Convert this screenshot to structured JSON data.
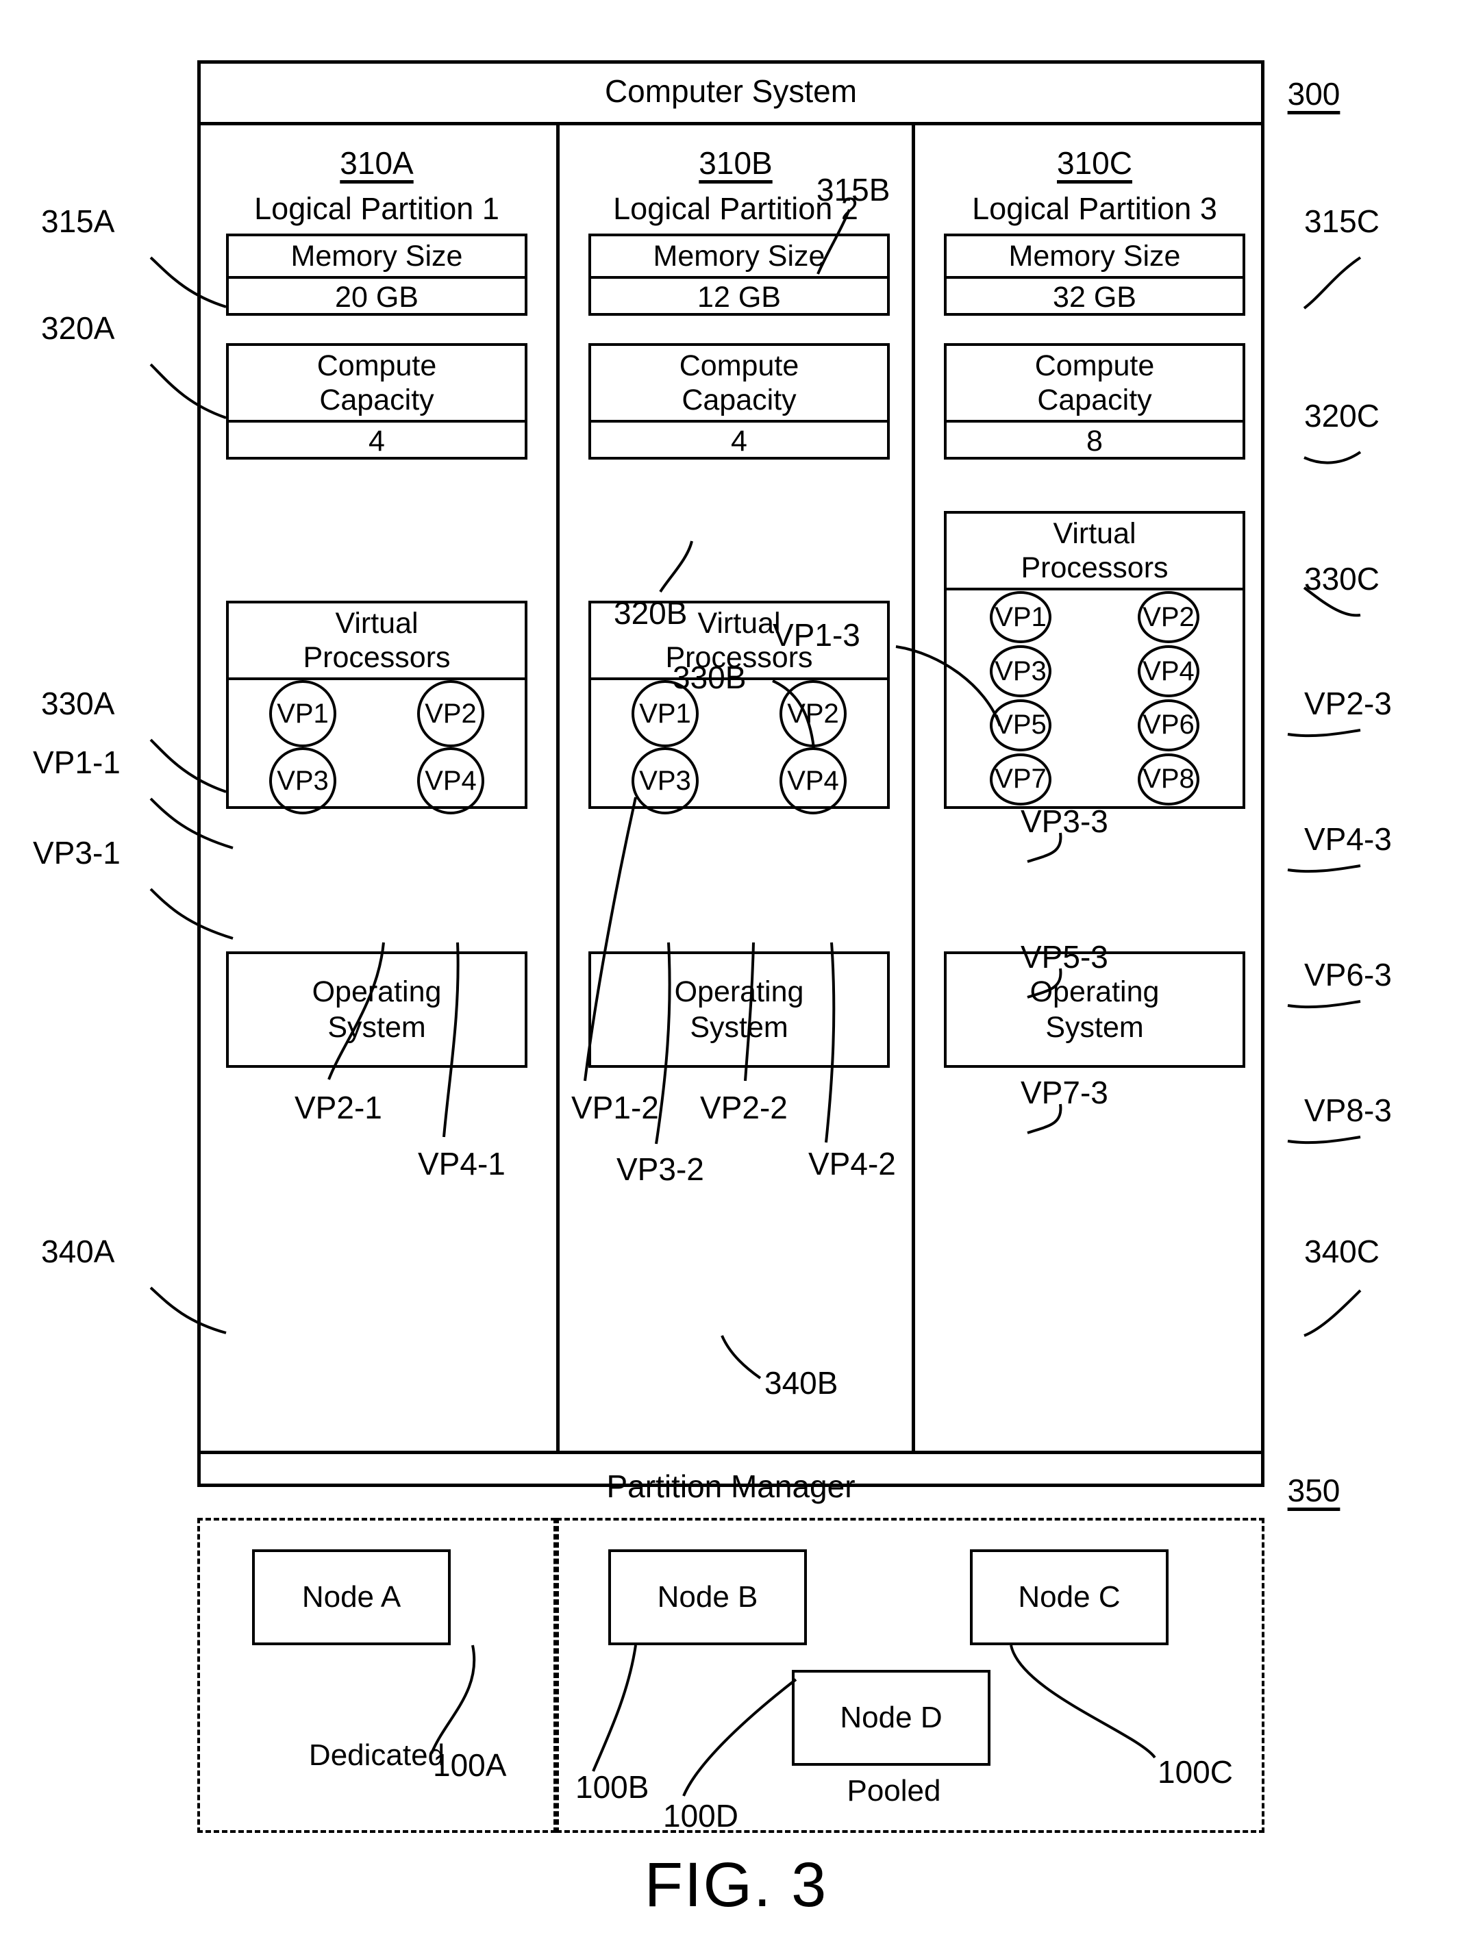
{
  "figure": {
    "caption": "FIG. 3"
  },
  "system": {
    "title": "Computer System",
    "ref": "300"
  },
  "partition_manager": {
    "title": "Partition Manager",
    "ref": "350"
  },
  "partitions": [
    {
      "ref": "310A",
      "name": "Logical Partition 1",
      "memory": {
        "label": "Memory Size",
        "value": "20 GB",
        "ref": "315A"
      },
      "capacity": {
        "label": "Compute Capacity",
        "line1": "Compute",
        "line2": "Capacity",
        "value": "4",
        "ref": "320A"
      },
      "virtual_processors": {
        "label": "Virtual Processors",
        "line1": "Virtual",
        "line2": "Processors",
        "ref": "330A",
        "items": [
          "VP1",
          "VP2",
          "VP3",
          "VP4"
        ],
        "item_refs": [
          "VP1-1",
          "VP2-1",
          "VP3-1",
          "VP4-1"
        ]
      },
      "os": {
        "line1": "Operating",
        "line2": "System",
        "ref": "340A"
      }
    },
    {
      "ref": "310B",
      "name": "Logical Partition 2",
      "memory": {
        "label": "Memory Size",
        "value": "12 GB",
        "ref": "315B"
      },
      "capacity": {
        "label": "Compute Capacity",
        "line1": "Compute",
        "line2": "Capacity",
        "value": "4",
        "ref": "320B"
      },
      "virtual_processors": {
        "label": "Virtual Processors",
        "line1": "Virtual",
        "line2": "Processors",
        "ref": "330B",
        "items": [
          "VP1",
          "VP2",
          "VP3",
          "VP4"
        ],
        "item_refs": [
          "VP1-2",
          "VP2-2",
          "VP3-2",
          "VP4-2"
        ]
      },
      "os": {
        "line1": "Operating",
        "line2": "System",
        "ref": "340B"
      }
    },
    {
      "ref": "310C",
      "name": "Logical Partition 3",
      "memory": {
        "label": "Memory Size",
        "value": "32 GB",
        "ref": "315C"
      },
      "capacity": {
        "label": "Compute Capacity",
        "line1": "Compute",
        "line2": "Capacity",
        "value": "8",
        "ref": "320C"
      },
      "virtual_processors": {
        "label": "Virtual Processors",
        "line1": "Virtual",
        "line2": "Processors",
        "ref": "330C",
        "items": [
          "VP1",
          "VP2",
          "VP3",
          "VP4",
          "VP5",
          "VP6",
          "VP7",
          "VP8"
        ],
        "item_refs": [
          "VP1-3",
          "VP2-3",
          "VP3-3",
          "VP4-3",
          "VP5-3",
          "VP6-3",
          "VP7-3",
          "VP8-3"
        ]
      },
      "os": {
        "line1": "Operating",
        "line2": "System",
        "ref": "340C"
      }
    }
  ],
  "node_pools": [
    {
      "mode_label": "Dedicated",
      "nodes": [
        {
          "label": "Node A",
          "ref": "100A"
        }
      ]
    },
    {
      "mode_label": "Pooled",
      "nodes": [
        {
          "label": "Node B",
          "ref": "100B"
        },
        {
          "label": "Node C",
          "ref": "100C"
        },
        {
          "label": "Node D",
          "ref": "100D"
        }
      ]
    }
  ],
  "colors": {
    "ink": "#000000",
    "paper": "#ffffff"
  }
}
